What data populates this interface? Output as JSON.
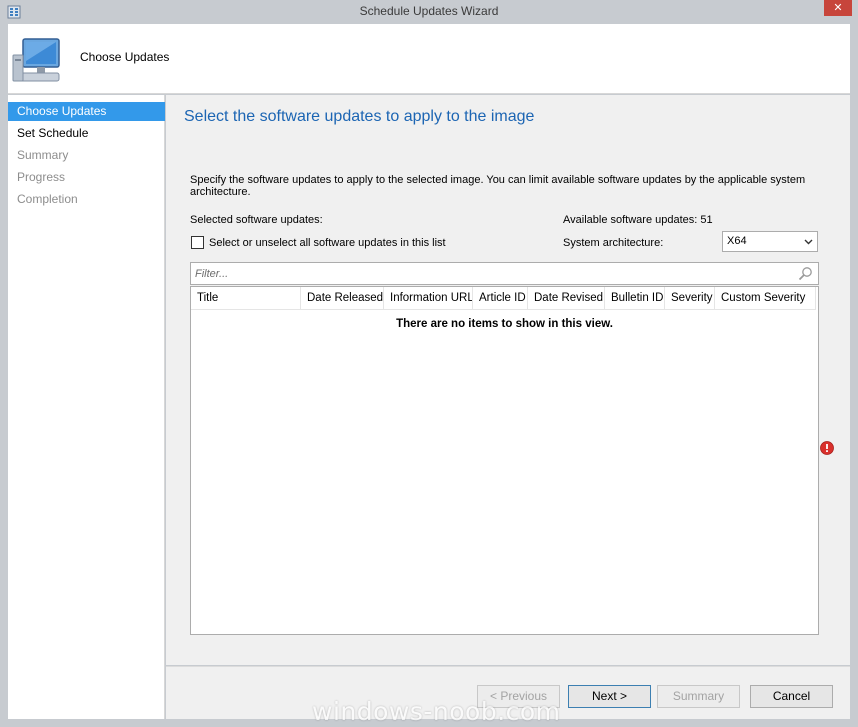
{
  "window": {
    "title": "Schedule Updates Wizard",
    "close_glyph": "✕"
  },
  "header": {
    "title": "Choose Updates",
    "icon": "computer-icon"
  },
  "sidebar": {
    "items": [
      {
        "label": "Choose Updates",
        "state": "active"
      },
      {
        "label": "Set Schedule",
        "state": "normal"
      },
      {
        "label": "Summary",
        "state": "disabled"
      },
      {
        "label": "Progress",
        "state": "disabled"
      },
      {
        "label": "Completion",
        "state": "disabled"
      }
    ]
  },
  "main": {
    "heading": "Select the software updates to apply to the image",
    "description": "Specify the software updates to apply to the selected image. You can limit available software updates by the applicable system architecture.",
    "selected_label": "Selected software updates:",
    "available_label": "Available software updates: 51",
    "select_all_label": "Select or unselect all software updates in this list",
    "select_all_checked": false,
    "arch_label": "System architecture:",
    "arch_value": "X64",
    "filter_placeholder": "Filter...",
    "columns": [
      "Title",
      "Date Released",
      "Information URL",
      "Article ID",
      "Date Revised",
      "Bulletin ID",
      "Severity",
      "Custom Severity"
    ],
    "empty_message": "There are no items to show in this view."
  },
  "footer": {
    "previous": "< Previous",
    "next": "Next >",
    "summary": "Summary",
    "cancel": "Cancel"
  },
  "watermark": "windows-noob.com",
  "colors": {
    "accent": "#3399ea",
    "heading": "#1c65b3",
    "error": "#d9302c",
    "close": "#c7453b"
  }
}
